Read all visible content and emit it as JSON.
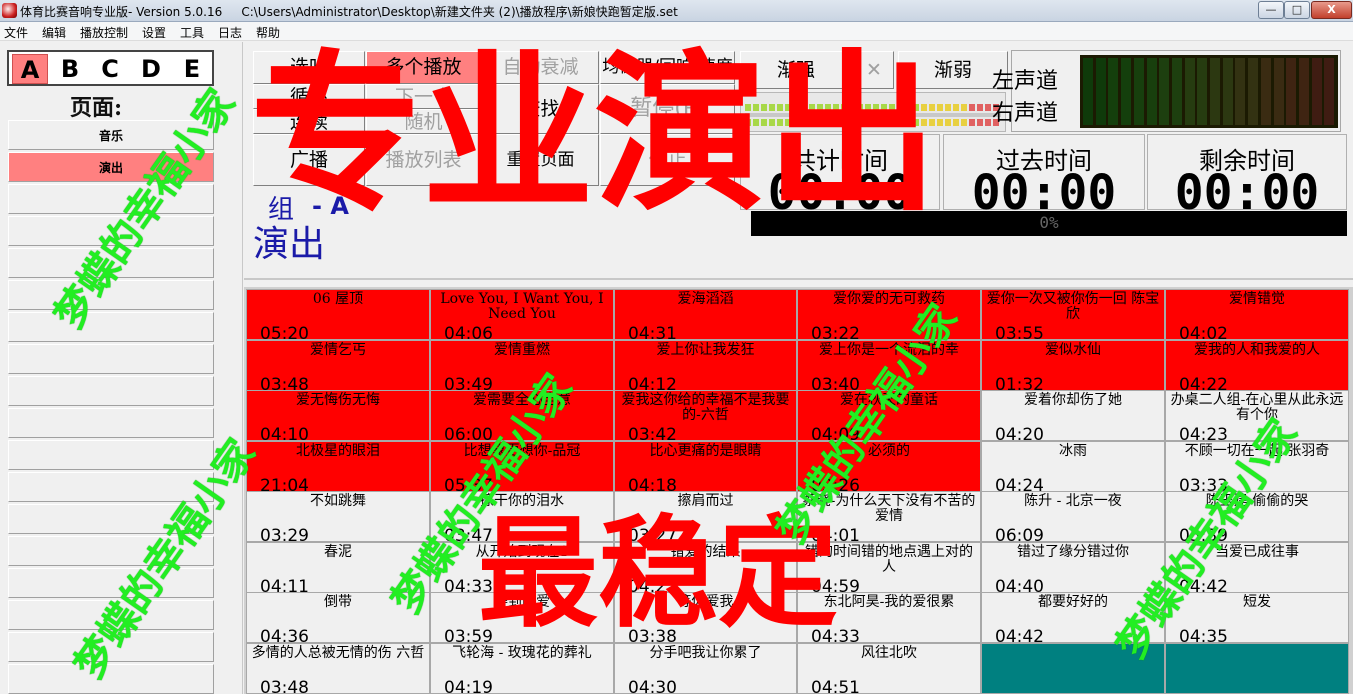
{
  "window": {
    "title": "体育比赛音响专业版- Version 5.0.16     C:\\Users\\Administrator\\Desktop\\新建文件夹 (2)\\播放程序\\新娘快跑暂定版.set",
    "min_label": "—",
    "max_label": "□",
    "close_label": "X"
  },
  "menu": [
    "文件",
    "编辑",
    "播放控制",
    "设置",
    "工具",
    "日志",
    "帮助"
  ],
  "left": {
    "letters": [
      "A",
      "B",
      "C",
      "D",
      "E"
    ],
    "active_letter": "A",
    "page_label": "页面:",
    "pages": [
      "音乐",
      "演出",
      "",
      "",
      "",
      "",
      "",
      "",
      "",
      "",
      "",
      "",
      "",
      "",
      "",
      "",
      "",
      ""
    ],
    "active_page": 1
  },
  "controls": {
    "preview": "选听",
    "multi_play": "多个播放",
    "auto_fade": "自动衰减",
    "eq": "均衡器/回响/速度",
    "loop": "循环",
    "next": "下一个",
    "find": "查找",
    "pause": "暂停(P)",
    "continuous": "连续",
    "random": "随机",
    "broadcast": "广播",
    "playlist": "播放列表",
    "reset_page": "重置页面",
    "stop": "停止",
    "fade_in": "渐强",
    "fade_x": "✕",
    "fade_out": "渐弱",
    "left_channel": "左声道",
    "right_channel": "右声道",
    "total_time_label": "共计时间",
    "total_time": "00:00",
    "elapsed_label": "过去时间",
    "elapsed": "00:00",
    "remaining_label": "剩余时间",
    "remaining": "00:00",
    "progress_text": "0%",
    "group_label": "组",
    "group_value": "- A",
    "page_name": "演出"
  },
  "songs": [
    {
      "title": "06   屋顶",
      "dur": "05:20",
      "state": "played"
    },
    {
      "title": "Love You, I Want You, I Need You",
      "dur": "04:06",
      "state": "played"
    },
    {
      "title": "爱海滔滔",
      "dur": "04:31",
      "state": "played"
    },
    {
      "title": "爱你爱的无可救药",
      "dur": "03:22",
      "state": "played"
    },
    {
      "title": "爱你一次又被你伤一回 陈宝欣",
      "dur": "03:55",
      "state": "played"
    },
    {
      "title": "爱情错觉",
      "dur": "04:02",
      "state": "played"
    },
    {
      "title": "爱情乞丐",
      "dur": "03:48",
      "state": "played"
    },
    {
      "title": "爱情重燃",
      "dur": "03:49",
      "state": "played"
    },
    {
      "title": "爱上你让我发狂",
      "dur": "04:12",
      "state": "played"
    },
    {
      "title": "爱上你是一个流泪的幸",
      "dur": "03:40",
      "state": "played"
    },
    {
      "title": "爱似水仙",
      "dur": "01:32",
      "state": "played"
    },
    {
      "title": "爱我的人和我爱的人",
      "dur": "04:22",
      "state": "played"
    },
    {
      "title": "爱无悔伤无悔",
      "dur": "04:10",
      "state": "played"
    },
    {
      "title": "爱需要全心全意",
      "dur": "06:00",
      "state": "played"
    },
    {
      "title": "爱我这你给的幸福不是我要的-六哲",
      "dur": "03:42",
      "state": "played"
    },
    {
      "title": "爱在秋天的童话",
      "dur": "04:09",
      "state": "played"
    },
    {
      "title": "爱着你却伤了她",
      "dur": "04:20",
      "state": "normal"
    },
    {
      "title": "办桌二人组-在心里从此永远有个你",
      "dur": "04:23",
      "state": "normal"
    },
    {
      "title": "北极星的眼泪",
      "dur": "21:04",
      "state": "played"
    },
    {
      "title": "比想象更想你-品冠",
      "dur": "05:37",
      "state": "played"
    },
    {
      "title": "比心更痛的是眼睛",
      "dur": "04:18",
      "state": "played"
    },
    {
      "title": "必须的",
      "dur": "03:26",
      "state": "played"
    },
    {
      "title": "冰雨",
      "dur": "04:24",
      "state": "normal"
    },
    {
      "title": "不顾一切在一起 张羽奇",
      "dur": "03:33",
      "state": "normal"
    },
    {
      "title": "不如跳舞",
      "dur": "03:29",
      "state": "normal"
    },
    {
      "title": "擦干你的泪水",
      "dur": "03:47",
      "state": "normal"
    },
    {
      "title": "擦肩而过",
      "dur": "03:27",
      "state": "normal"
    },
    {
      "title": "蔡晓-为什么天下没有不苦的爱情",
      "dur": "04:01",
      "state": "normal"
    },
    {
      "title": "陈升 - 北京一夜",
      "dur": "06:09",
      "state": "normal"
    },
    {
      "title": "陈玉建   偷偷的哭",
      "dur": "05:39",
      "state": "normal"
    },
    {
      "title": "春泥",
      "dur": "04:11",
      "state": "normal"
    },
    {
      "title": "从开始到现在1",
      "dur": "04:33",
      "state": "normal"
    },
    {
      "title": "错爱的结果",
      "dur": "04:25",
      "state": "normal"
    },
    {
      "title": "错的时间错的地点遇上对的人",
      "dur": "04:59",
      "state": "normal"
    },
    {
      "title": "错过了缘分错过你",
      "dur": "04:40",
      "state": "normal"
    },
    {
      "title": "当爱已成往事",
      "dur": "04:42",
      "state": "normal"
    },
    {
      "title": "倒带",
      "dur": "04:36",
      "state": "normal"
    },
    {
      "title": "得到的爱",
      "dur": "03:59",
      "state": "normal"
    },
    {
      "title": "等你爱我",
      "dur": "03:38",
      "state": "normal"
    },
    {
      "title": "东北阿昊-我的爱很累",
      "dur": "04:33",
      "state": "normal"
    },
    {
      "title": "都要好好的",
      "dur": "04:42",
      "state": "normal"
    },
    {
      "title": "短发",
      "dur": "04:35",
      "state": "normal"
    },
    {
      "title": "多情的人总被无情的伤 六哲",
      "dur": "03:48",
      "state": "normal"
    },
    {
      "title": "飞轮海 - 玫瑰花的葬礼",
      "dur": "04:19",
      "state": "normal"
    },
    {
      "title": "分手吧我让你累了",
      "dur": "04:30",
      "state": "normal"
    },
    {
      "title": "风往北吹",
      "dur": "04:51",
      "state": "normal"
    },
    {
      "title": "",
      "dur": "",
      "state": "empty"
    },
    {
      "title": "",
      "dur": "",
      "state": "empty"
    }
  ],
  "watermarks": {
    "big_top": "专业演出",
    "big_bottom": "最稳定",
    "green": "梦蝶的幸福小家"
  },
  "colors": {
    "played": "#ff0000",
    "active_page": "#ff8080",
    "empty_slot": "#008080",
    "watermark_red": "#ff0000",
    "watermark_green": "#22ee22",
    "group_text": "#1a1aa8"
  }
}
